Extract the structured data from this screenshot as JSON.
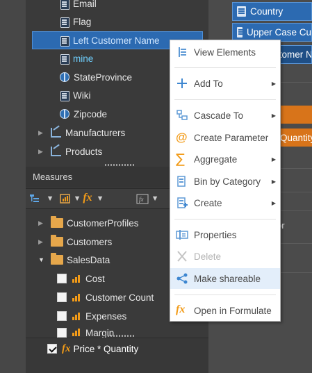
{
  "tree_top": {
    "items": [
      {
        "label": "Email",
        "icon": "attribute-icon"
      },
      {
        "label": "Flag",
        "icon": "attribute-icon"
      },
      {
        "label": "Left Customer Name",
        "icon": "attribute-icon",
        "selected": true
      },
      {
        "label": "mine",
        "icon": "attribute-icon"
      },
      {
        "label": "StateProvince",
        "icon": "globe-icon"
      },
      {
        "label": "Wiki",
        "icon": "attribute-icon"
      },
      {
        "label": "Zipcode",
        "icon": "globe-icon"
      },
      {
        "label": "Manufacturers",
        "icon": "hierarchy-icon"
      },
      {
        "label": "Products",
        "icon": "hierarchy-icon"
      }
    ]
  },
  "measures": {
    "title": "Measures",
    "folders": [
      "CustomerProfiles",
      "Customers",
      "SalesData"
    ],
    "items": [
      "Cost",
      "Customer Count",
      "Expenses",
      "Margin"
    ],
    "calculated": "Price * Quantity"
  },
  "right_panel": {
    "pills": [
      "Country",
      "Upper Case Cu",
      "stomer N"
    ],
    "orange_label": "Quantity",
    "side_text": "or"
  },
  "context_menu": {
    "items": [
      {
        "label": "View Elements",
        "icon": "view-elements-icon",
        "submenu": false
      },
      {
        "label": "Add To",
        "icon": "plus-icon",
        "submenu": true
      },
      {
        "label": "Cascade To",
        "icon": "cascade-icon",
        "submenu": true
      },
      {
        "label": "Create Parameter",
        "icon": "at-icon",
        "submenu": false
      },
      {
        "label": "Aggregate",
        "icon": "sum-icon",
        "submenu": true
      },
      {
        "label": "Bin by Category",
        "icon": "bin-icon",
        "submenu": true
      },
      {
        "label": "Create",
        "icon": "create-icon",
        "submenu": true
      },
      {
        "label": "Properties",
        "icon": "properties-icon",
        "submenu": false
      },
      {
        "label": "Delete",
        "icon": "delete-icon",
        "submenu": false,
        "disabled": true
      },
      {
        "label": "Make shareable",
        "icon": "share-icon",
        "submenu": false,
        "highlighted": true
      },
      {
        "label": "Open in Formulate",
        "icon": "fx-icon",
        "submenu": false
      }
    ]
  },
  "colors": {
    "accent": "#2c6ab1",
    "orange": "#f29b18",
    "menu_highlight": "#e3eefa"
  }
}
